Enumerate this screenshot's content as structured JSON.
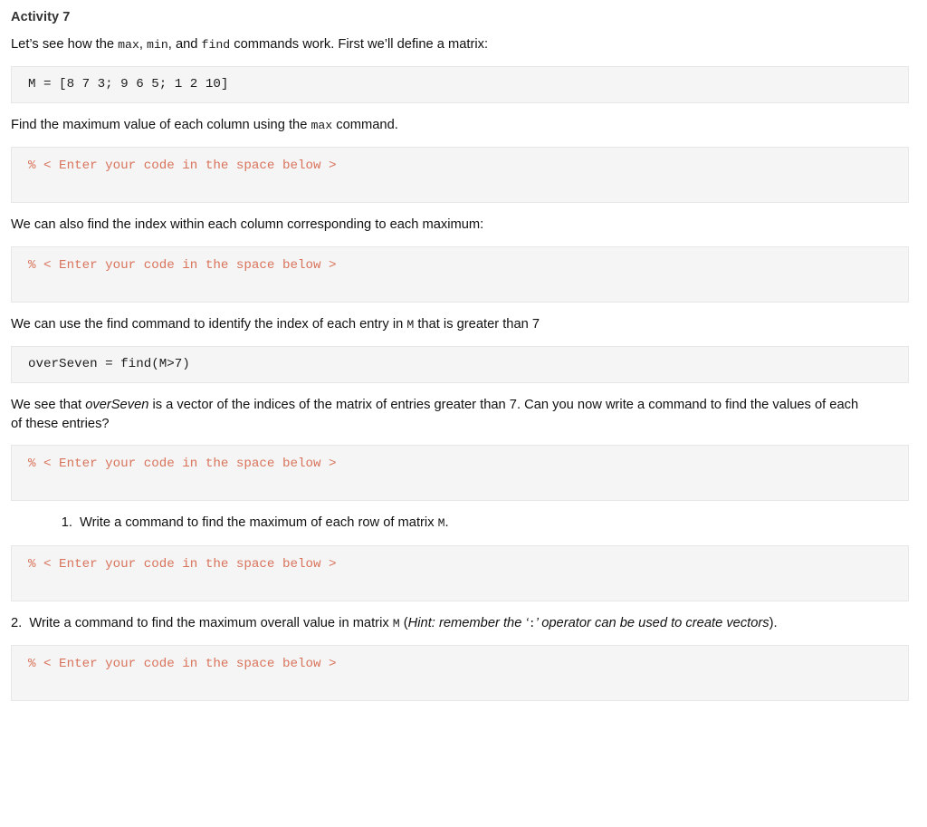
{
  "heading": {
    "title": "Activity 7"
  },
  "intro": {
    "text_1": "Let’s see how the ",
    "code_max": "max",
    "text_2": ", ",
    "code_min": "min",
    "text_3": ", and ",
    "code_find": "find",
    "text_4": " commands work. First we’ll define a matrix:"
  },
  "matrix_block": {
    "code": "M = [8 7 3; 9 6 5; 1 2 10]"
  },
  "prompt_max_column": {
    "text_1": "Find the maximum value of each column using the ",
    "code_max": "max",
    "text_2": " command."
  },
  "answer_placeholder": "% < Enter your code in the space below >",
  "prompt_index_column": {
    "text": "We can also find the index within each column corresponding to each maximum:"
  },
  "prompt_find": {
    "text_1": "We can use the find command to identify the index of each entry in ",
    "code_M": "M",
    "text_2": " that is greater than 7"
  },
  "overseven_block": {
    "code": "overSeven = find(M>7)"
  },
  "prompt_overseven": {
    "text_1": "We see that ",
    "emphasis": "overSeven",
    "text_2": " is a vector of the indices of the  matrix of entries greater than 7. Can you now write a command to find the values of each of these entries?"
  },
  "task_one": {
    "marker": "1.",
    "text_1": "Write a command to find the maximum of each row of matrix ",
    "code_M": "M",
    "text_2": "."
  },
  "task_two": {
    "marker": "2.",
    "text_1": "Write a command to find the maximum overall value in matrix ",
    "code_M": "M",
    "text_2": " (",
    "hint_1": "Hint: remember the ‘",
    "hint_code": ":",
    "hint_2": "’ operator can be used to create vectors",
    "text_3": ")."
  },
  "colors": {
    "code_background": "#f5f5f5",
    "code_border": "#e7e7e7",
    "placeholder_text": "#d9745c",
    "body_text": "#111111",
    "heading_text": "#333333"
  }
}
